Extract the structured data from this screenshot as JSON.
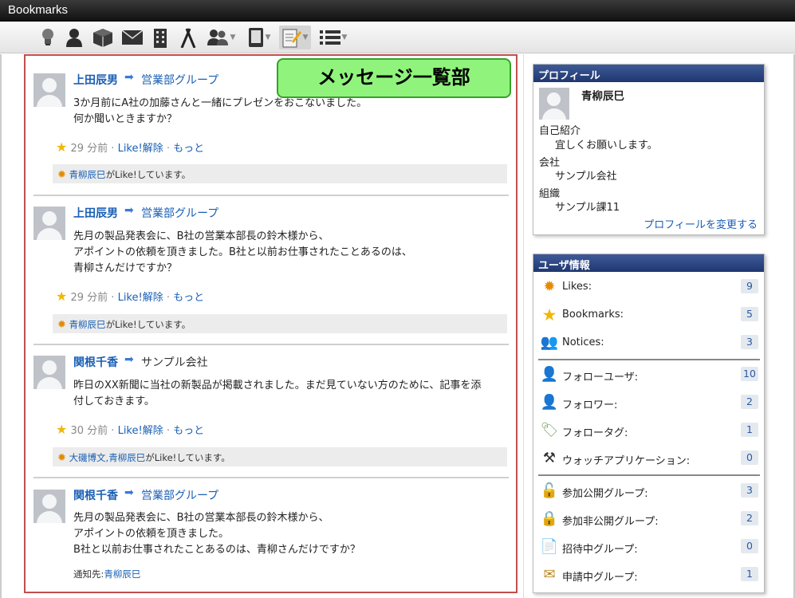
{
  "window": {
    "title": "Bookmarks"
  },
  "toolbar": {
    "icons": [
      "lightbulb-icon",
      "person-icon",
      "box-icon",
      "mail-icon",
      "building-icon",
      "tools-icon",
      "group-icon",
      "device-icon",
      "note-pen-icon",
      "list-icon"
    ]
  },
  "callout": {
    "label": "メッセージ一覧部"
  },
  "posts": [
    {
      "author": "上田辰男",
      "target": "営業部グループ",
      "body": "3か月前にA社の加藤さんと一緒にプレゼンをおこないました。\n何か聞いときますか？",
      "time": "29 分前",
      "like_action": "Like!解除",
      "more": "もっと",
      "liked_by": "青柳辰巳",
      "liked_suffix": "がLike!しています。"
    },
    {
      "author": "上田辰男",
      "target": "営業部グループ",
      "body": "先月の製品発表会に、B社の営業本部長の鈴木様から、\nアポイントの依頼を頂きました。B社と以前お仕事されたことあるのは、\n青柳さんだけですか？",
      "time": "29 分前",
      "like_action": "Like!解除",
      "more": "もっと",
      "liked_by": "青柳辰巳",
      "liked_suffix": "がLike!しています。"
    },
    {
      "author": "関根千香",
      "target": "サンプル会社",
      "body": "昨日のXX新聞に当社の新製品が掲載されました。まだ見ていない方のために、記事を添\n付しておきます。",
      "time": "30 分前",
      "like_action": "Like!解除",
      "more": "もっと",
      "liked_by": "大磯博文,青柳辰巳",
      "liked_suffix": "がLike!しています。"
    },
    {
      "author": "関根千香",
      "target": "営業部グループ",
      "body": "先月の製品発表会に、B社の営業本部長の鈴木様から、\nアポイントの依頼を頂きました。\nB社と以前お仕事されたことあるのは、青柳さんだけですか？",
      "notice_label": "通知先:",
      "notice_user": "青柳辰巳"
    }
  ],
  "profile": {
    "header": "プロフィール",
    "name": "青柳辰巳",
    "intro_label": "自己紹介",
    "intro_value": "宜しくお願いします。",
    "company_label": "会社",
    "company_value": "サンプル会社",
    "org_label": "組織",
    "org_value": "サンプル課11",
    "edit_link": "プロフィールを変更する"
  },
  "user_info": {
    "header": "ユーザ情報",
    "rows": [
      {
        "icon": "sun-icon",
        "label": "Likes:",
        "count": "9"
      },
      {
        "icon": "star-icon",
        "label": "Bookmarks:",
        "count": "5"
      },
      {
        "icon": "people-icon",
        "label": "Notices:",
        "count": "3"
      },
      {
        "icon": "follow-user-icon",
        "label": "フォローユーザ:",
        "count": "10"
      },
      {
        "icon": "follower-icon",
        "label": "フォロワー:",
        "count": "2"
      },
      {
        "icon": "tag-icon",
        "label": "フォロータグ:",
        "count": "1"
      },
      {
        "icon": "tools-icon",
        "label": "ウォッチアプリケーション:",
        "count": "0"
      },
      {
        "icon": "unlock-icon",
        "label": "参加公開グループ:",
        "count": "3"
      },
      {
        "icon": "lock-icon",
        "label": "参加非公開グループ:",
        "count": "2"
      },
      {
        "icon": "invite-icon",
        "label": "招待中グループ:",
        "count": "0"
      },
      {
        "icon": "envelope-icon",
        "label": "申請中グループ:",
        "count": "1"
      }
    ]
  }
}
